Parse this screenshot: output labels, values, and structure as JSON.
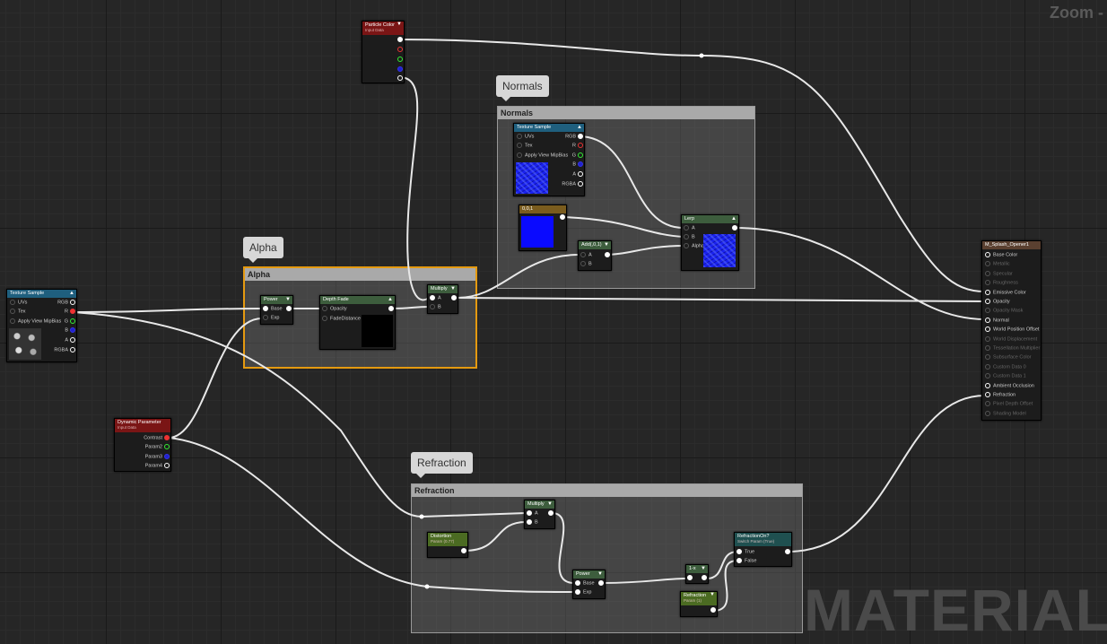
{
  "editor": {
    "zoom_label": "Zoom -",
    "watermark": "MATERIAL"
  },
  "comments": {
    "normals": {
      "bubble": "Normals",
      "bar": "Normals"
    },
    "alpha": {
      "bubble": "Alpha",
      "bar": "Alpha"
    },
    "refraction": {
      "bubble": "Refraction",
      "bar": "Refraction"
    }
  },
  "nodes": {
    "particle_color": {
      "title": "Particle Color",
      "subtitle": "Input Data"
    },
    "texture_sample_normals": {
      "title": "Texture Sample",
      "inputs": [
        "UVs",
        "Tex",
        "Apply View MipBias"
      ],
      "outputs": [
        "RGB",
        "R",
        "G",
        "B",
        "A",
        "RGBA"
      ]
    },
    "const_vec": {
      "title": "0,0,1"
    },
    "lerp": {
      "title": "Lerp",
      "inputs": [
        "A",
        "B",
        "Alpha"
      ]
    },
    "add": {
      "title": "Add(,0,1)",
      "inputs": [
        "A",
        "B"
      ]
    },
    "texture_sample_alpha": {
      "title": "Texture Sample",
      "inputs": [
        "UVs",
        "Tex",
        "Apply View MipBias"
      ],
      "outputs": [
        "RGB",
        "R",
        "G",
        "B",
        "A",
        "RGBA"
      ]
    },
    "power_alpha": {
      "title": "Power",
      "inputs": [
        "Base",
        "Exp"
      ]
    },
    "depth_fade": {
      "title": "Depth Fade",
      "inputs": [
        "Opacity",
        "FadeDistance"
      ]
    },
    "multiply_alpha": {
      "title": "Multiply",
      "inputs": [
        "A",
        "B"
      ]
    },
    "dynamic_param": {
      "title": "Dynamic Parameter",
      "subtitle": "Input Data",
      "outputs": [
        "Contrast",
        "Param2",
        "Param3",
        "Param4"
      ]
    },
    "material_result": {
      "title": "M_Splash_Opener1",
      "inputs": [
        "Base Color",
        "Metallic",
        "Specular",
        "Roughness",
        "Emissive Color",
        "Opacity",
        "Opacity Mask",
        "Normal",
        "World Position Offset",
        "World Displacement",
        "Tessellation Multiplier",
        "Subsurface Color",
        "Custom Data 0",
        "Custom Data 1",
        "Ambient Occlusion",
        "Refraction",
        "Pixel Depth Offset",
        "Shading Model"
      ],
      "active": [
        true,
        false,
        false,
        false,
        true,
        true,
        false,
        true,
        true,
        false,
        false,
        false,
        false,
        false,
        true,
        true,
        false,
        false
      ]
    },
    "multiply_refr": {
      "title": "Multiply",
      "inputs": [
        "A",
        "B"
      ]
    },
    "distortion": {
      "title": "Distortion",
      "subtitle": "Param (0.77)"
    },
    "power_refr": {
      "title": "Power",
      "inputs": [
        "Base",
        "Exp"
      ]
    },
    "one_minus": {
      "title": "1-x"
    },
    "refraction_on": {
      "title": "RefractionOn?",
      "subtitle": "Switch Param (True)",
      "inputs": [
        "True",
        "False"
      ]
    },
    "refraction_param": {
      "title": "Refraction",
      "subtitle": "Param (1)"
    }
  },
  "colors": {
    "normal_map": "#1a22ee",
    "selection": "#e59a10",
    "vector_header": "#7a5c1e",
    "texture_header": "#1f5f7e",
    "math_header": "#3d5d3d",
    "param_header": "#4b6b22",
    "dynamic_header": "#7a1515",
    "result_header": "#5a4030"
  }
}
